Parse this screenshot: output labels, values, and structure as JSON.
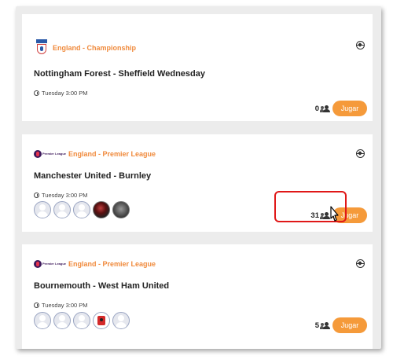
{
  "matches": [
    {
      "league": "England - Championship",
      "title": "Nottingham Forest - Sheffield Wednesday",
      "time": "Tuesday 3:00 PM",
      "players": "0",
      "button": "Jugar"
    },
    {
      "league": "England - Premier League",
      "logo_text": "Premier League",
      "title": "Manchester United - Burnley",
      "time": "Tuesday 3:00 PM",
      "players": "31",
      "button": "Jugar"
    },
    {
      "league": "England - Premier League",
      "logo_text": "Premier League",
      "title": "Bournemouth - West Ham United",
      "time": "Tuesday 3:00 PM",
      "players": "5",
      "button": "Jugar"
    }
  ],
  "colors": {
    "accent": "#f59a3a",
    "league_text": "#f08a3c",
    "highlight": "#e01818"
  },
  "icons": [
    "championship-logo",
    "premier-league-logo",
    "soccer-ball-icon",
    "clock-icon",
    "users-icon",
    "cursor-icon"
  ]
}
